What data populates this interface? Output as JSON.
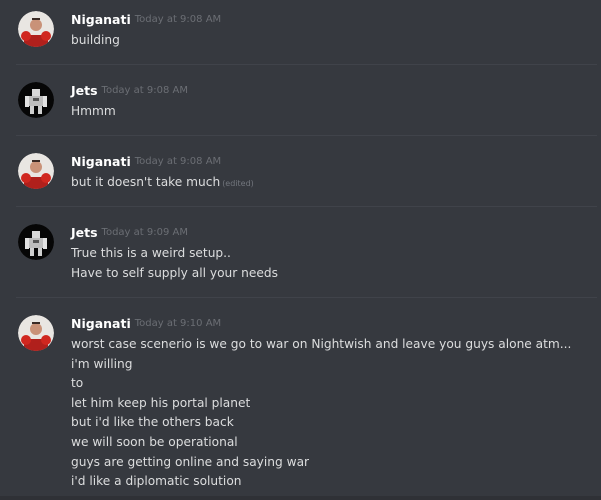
{
  "colors": {
    "background": "#36393f",
    "username": "#ffffff",
    "timestamp": "#6b6e74",
    "text": "#dcddde",
    "divider": "#40434a"
  },
  "messages": [
    {
      "author": "Niganati",
      "avatar_icon": "boxer-avatar-icon",
      "timestamp": "Today at 9:08 AM",
      "lines": [
        "building"
      ]
    },
    {
      "author": "Jets",
      "avatar_icon": "mech-robot-avatar-icon",
      "timestamp": "Today at 9:08 AM",
      "lines": [
        "Hmmm"
      ]
    },
    {
      "author": "Niganati",
      "avatar_icon": "boxer-avatar-icon",
      "timestamp": "Today at 9:08 AM",
      "lines": [
        "but it doesn't take much"
      ],
      "edited": "(edited)"
    },
    {
      "author": "Jets",
      "avatar_icon": "mech-robot-avatar-icon",
      "timestamp": "Today at 9:09 AM",
      "lines": [
        "True this is a weird setup..",
        "Have to self supply all your needs"
      ]
    },
    {
      "author": "Niganati",
      "avatar_icon": "boxer-avatar-icon",
      "timestamp": "Today at 9:10 AM",
      "lines": [
        "worst case scenerio is we go to war on Nightwish and leave you guys alone atm...",
        "i'm willing",
        "to",
        "let him keep his portal planet",
        "but i'd like the others back",
        "we will soon be operational",
        "guys are getting online and saying war",
        "i'd like a diplomatic solution"
      ]
    }
  ]
}
